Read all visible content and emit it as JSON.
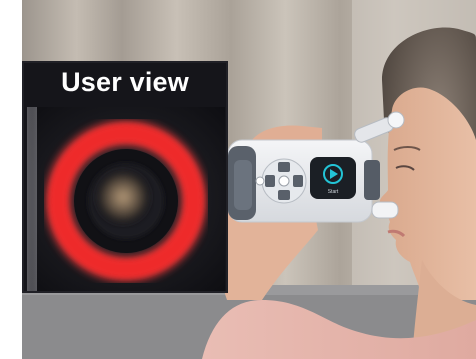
{
  "inset": {
    "title": "User view"
  },
  "device": {
    "screen_label": "Start"
  },
  "colors": {
    "ring_red": "#ee2a2a",
    "device_body": "#e9ebee",
    "device_accent": "#58606b",
    "play_accent": "#23c4d6",
    "curtain": "#b9b0a6",
    "sofa": "#8a8a8c",
    "top_pink": "#e6b5ad"
  },
  "icons": [
    "play-icon",
    "dpad-icon"
  ]
}
